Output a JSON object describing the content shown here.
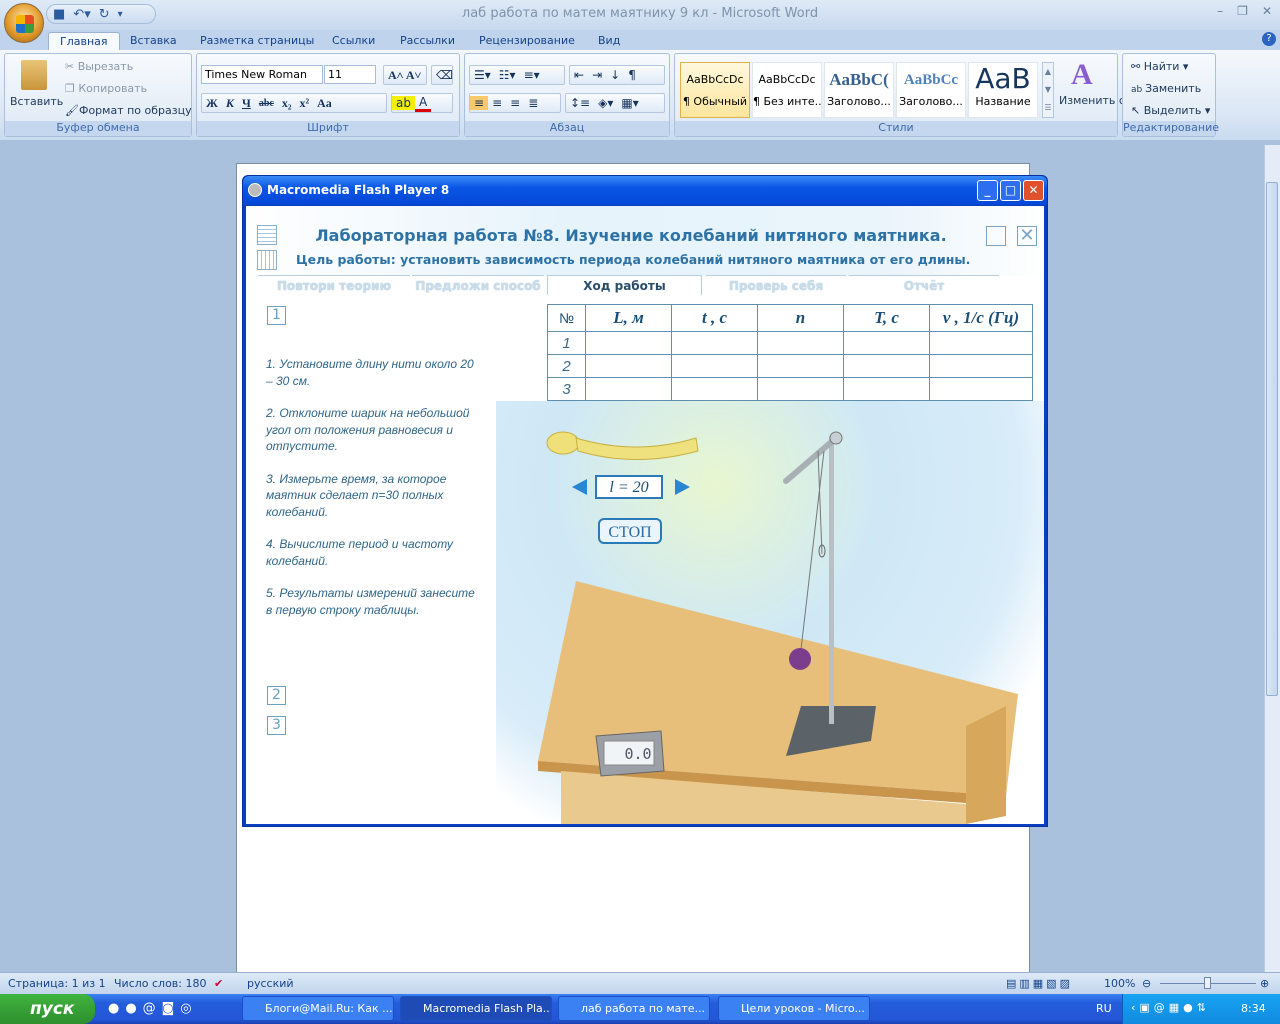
{
  "window": {
    "title": "лаб работа по матем маятнику 9 кл - Microsoft Word"
  },
  "ribbon": {
    "tabs": [
      "Главная",
      "Вставка",
      "Разметка страницы",
      "Ссылки",
      "Рассылки",
      "Рецензирование",
      "Вид"
    ],
    "clipboard": {
      "paste": "Вставить",
      "cut": "Вырезать",
      "copy": "Копировать",
      "format_painter": "Формат по образцу",
      "label": "Буфер обмена"
    },
    "font": {
      "name": "Times New Roman",
      "size": "11",
      "label": "Шрифт",
      "bold": "Ж",
      "italic": "К",
      "underline": "Ч",
      "strike": "abc",
      "sub": "x₂",
      "sup": "x²",
      "case": "Aa"
    },
    "paragraph": {
      "label": "Абзац"
    },
    "styles": {
      "label": "Стили",
      "items": [
        {
          "sample": "AaBbCcDc",
          "name": "¶ Обычный"
        },
        {
          "sample": "AaBbCcDc",
          "name": "¶ Без инте..."
        },
        {
          "sample": "AaBbC(",
          "name": "Заголово..."
        },
        {
          "sample": "AaBbCc",
          "name": "Заголово..."
        },
        {
          "sample": "AaB",
          "name": "Название"
        }
      ],
      "change": "Изменить стили"
    },
    "editing": {
      "label": "Редактирование",
      "find": "Найти",
      "replace": "Заменить",
      "select": "Выделить"
    }
  },
  "flash": {
    "title": "Macromedia Flash Player 8",
    "lab_title": "Лабораторная работа №8.  Изучение колебаний нитяного маятника.",
    "goal": "Цель работы: установить зависимость периода колебаний нитяного маятника от его длины.",
    "tabs": [
      "Повтори теорию",
      "Предложи способ",
      "Ход работы",
      "Проверь себя",
      "Отчёт"
    ],
    "active_tab": "Ход работы",
    "table": {
      "headers": [
        "№",
        "L, м",
        "t , с",
        "n",
        "T, с",
        "ν , 1/с (Гц)"
      ],
      "rows": [
        "1",
        "2",
        "3"
      ]
    },
    "steps": [
      "1",
      "2",
      "3"
    ],
    "instructions": [
      "1. Установите длину нити около 20 – 30 см.",
      "2. Отклоните шарик на небольшой угол  от положения равновесия и отпустите.",
      "3. Измерьте время, за которое маятник сделает n=30 полных колебаний.",
      "4. Вычислите период и частоту колебаний.",
      "5. Результаты измерений занесите в первую строку таблицы."
    ],
    "length_display": "l =  20",
    "stop_button": "СТОП",
    "timer": "0.0"
  },
  "status": {
    "page": "Страница: 1 из 1",
    "words": "Число слов: 180",
    "language": "русский",
    "zoom": "100%"
  },
  "taskbar": {
    "start": "пуск",
    "tasks": [
      "Блоги@Mail.Ru: Как ...",
      "Macromedia Flash Pla...",
      "лаб работа по мате...",
      "Цели уроков - Micro..."
    ],
    "lang": "RU",
    "clock": "8:34"
  }
}
